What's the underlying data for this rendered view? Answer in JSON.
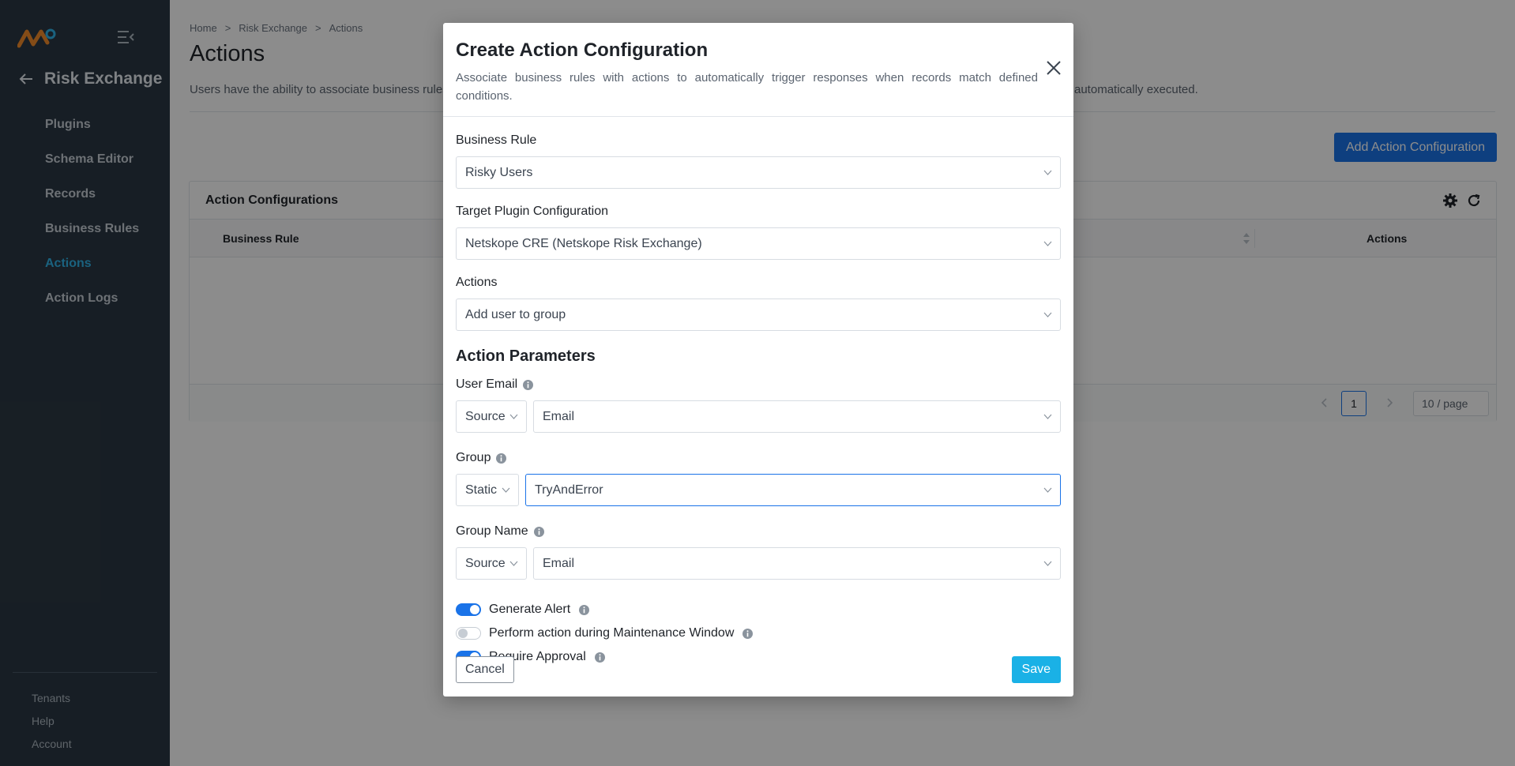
{
  "sidebar": {
    "back_title": "Risk Exchange",
    "items": [
      {
        "label": "Plugins",
        "active": false
      },
      {
        "label": "Schema Editor",
        "active": false
      },
      {
        "label": "Records",
        "active": false
      },
      {
        "label": "Business Rules",
        "active": false
      },
      {
        "label": "Actions",
        "active": true
      },
      {
        "label": "Action Logs",
        "active": false
      }
    ],
    "bottom": [
      "Tenants",
      "Help",
      "Account"
    ]
  },
  "main": {
    "breadcrumb": [
      "Home",
      ">",
      "Risk Exchange",
      ">",
      "Actions"
    ],
    "title": "Actions",
    "description": "Users have the ability to associate business rules",
    "description_tail": "automatically executed.",
    "add_button": "Add Action Configuration",
    "card_title": "Action Configurations",
    "columns": [
      "Business Rule",
      "Actions"
    ],
    "pager": {
      "page": "1",
      "page_size": "10 / page"
    }
  },
  "modal": {
    "title": "Create Action Configuration",
    "description": "Associate business rules with actions to automatically trigger responses when records match defined conditions.",
    "business_rule": {
      "label": "Business Rule",
      "value": "Risky Users"
    },
    "target_plugin": {
      "label": "Target Plugin Configuration",
      "value": "Netskope CRE (Netskope Risk Exchange)"
    },
    "actions": {
      "label": "Actions",
      "value": "Add user to group"
    },
    "params_title": "Action Parameters",
    "user_email": {
      "label": "User Email",
      "type": "Source",
      "value": "Email"
    },
    "group": {
      "label": "Group",
      "type": "Static",
      "value": "TryAndError"
    },
    "group_name": {
      "label": "Group Name",
      "type": "Source",
      "value": "Email"
    },
    "toggles": [
      {
        "label": "Generate Alert",
        "on": true
      },
      {
        "label": "Perform action during Maintenance Window",
        "on": false
      },
      {
        "label": "Require Approval",
        "on": true
      }
    ],
    "cancel": "Cancel",
    "save": "Save"
  },
  "colors": {
    "accent": "#1a73e8",
    "save": "#1ab1e6",
    "sidebar": "#2b3844",
    "active_nav": "#31b3e8"
  }
}
